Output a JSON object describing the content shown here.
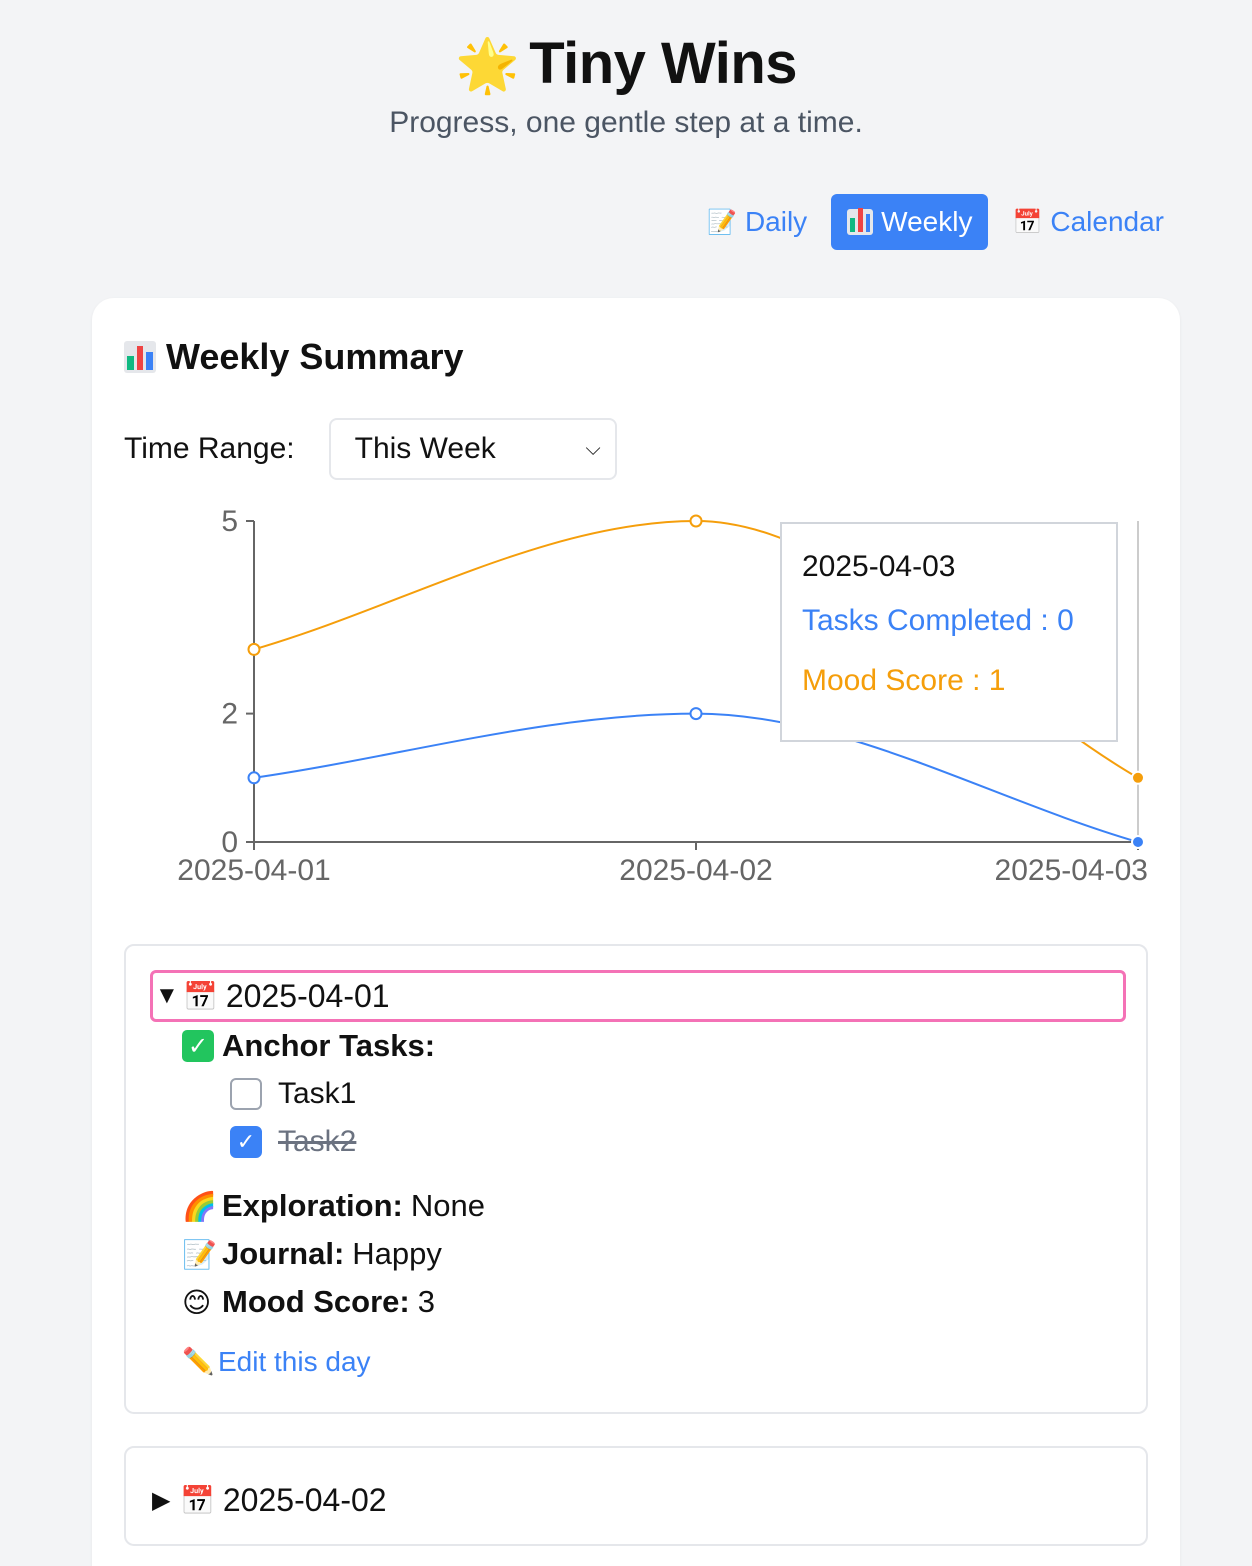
{
  "app": {
    "title": "Tiny Wins",
    "title_icon": "star-icon",
    "subtitle": "Progress, one gentle step at a time."
  },
  "nav": {
    "items": [
      {
        "label": "Daily",
        "icon": "memo-icon",
        "active": false
      },
      {
        "label": "Weekly",
        "icon": "bar-chart-icon",
        "active": true
      },
      {
        "label": "Calendar",
        "icon": "calendar-icon",
        "active": false
      }
    ]
  },
  "weekly": {
    "title": "Weekly Summary",
    "range_label": "Time Range:",
    "range_value": "This Week"
  },
  "colors": {
    "accent": "#3b82f6",
    "tasks_line": "#3b82f6",
    "mood_line": "#f59e0b",
    "highlight_border": "#f472b6"
  },
  "chart_data": {
    "type": "line",
    "categories": [
      "2025-04-01",
      "2025-04-02",
      "2025-04-03"
    ],
    "series": [
      {
        "name": "Tasks Completed",
        "values": [
          1,
          2,
          0
        ],
        "color": "#3b82f6"
      },
      {
        "name": "Mood Score",
        "values": [
          3,
          5,
          1
        ],
        "color": "#f59e0b"
      }
    ],
    "yticks": [
      0,
      2,
      5
    ],
    "ylim": [
      0,
      5
    ],
    "grid": false,
    "active_index": 2
  },
  "tooltip": {
    "date": "2025-04-03",
    "line1": "Tasks Completed : 0",
    "line2": "Mood Score : 1"
  },
  "days": [
    {
      "date": "2025-04-01",
      "expanded": true,
      "anchor_label": "Anchor Tasks:",
      "tasks": [
        {
          "label": "Task1",
          "done": false
        },
        {
          "label": "Task2",
          "done": true
        }
      ],
      "exploration_label": "Exploration:",
      "exploration": "None",
      "journal_label": "Journal:",
      "journal": "Happy",
      "mood_label": "Mood Score:",
      "mood": "3",
      "edit_label": "Edit this day"
    },
    {
      "date": "2025-04-02",
      "expanded": false
    }
  ]
}
